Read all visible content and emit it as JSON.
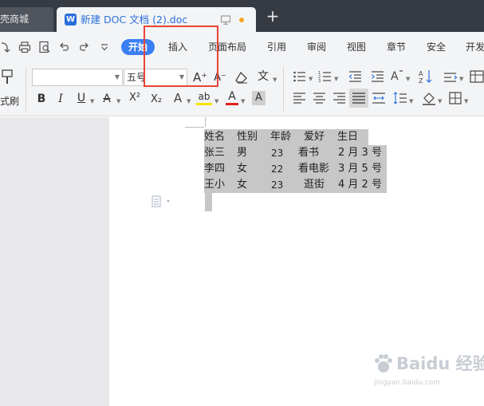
{
  "tabs": {
    "other_tab_label": "壳商城",
    "active_tab_label": "新建 DOC 文档 (2).doc",
    "new_tab_symbol": "+"
  },
  "menu": {
    "items": [
      "开始",
      "插入",
      "页面布局",
      "引用",
      "审阅",
      "视图",
      "章节",
      "安全",
      "开发"
    ],
    "active_index": 0
  },
  "ribbon": {
    "font_name_value": "",
    "font_size_value": "五号",
    "format_painter_label": "式刷",
    "bold": "B",
    "italic": "I",
    "underline": "U",
    "strikethrough": "A",
    "superscript": "X²",
    "subscript": "X₂",
    "text_effect": "A",
    "highlight": "ab",
    "font_color": "A",
    "char_shading": "A",
    "grow_font": "A⁺",
    "shrink_font": "A⁻",
    "phonetic": "文"
  },
  "document": {
    "table_header": [
      "姓名",
      "性别",
      "年龄",
      "爱好",
      "生日"
    ],
    "table_rows": [
      [
        "张三",
        "男",
        "23",
        "看书",
        "2 月 3 号"
      ],
      [
        "李四",
        "女",
        "22",
        "看电影",
        "3 月 5 号"
      ],
      [
        "王小",
        "女",
        "23",
        "逛街",
        "4 月 2 号"
      ]
    ]
  },
  "watermark": {
    "main": "Baidu 经验",
    "sub": "jingyan.baidu.com"
  },
  "colors": {
    "tabbar_bg": "#363a42",
    "accent": "#3b7ff3",
    "highlight_box": "#e84335",
    "selection": "#c7c7c7"
  }
}
